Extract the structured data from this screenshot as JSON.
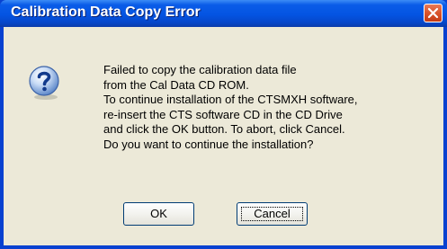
{
  "window": {
    "title": "Calibration Data Copy Error",
    "close_icon": "close-icon"
  },
  "message": {
    "icon": "question-icon",
    "lines": [
      "Failed to copy the calibration data file",
      "from the Cal Data CD ROM.",
      "To continue installation of the CTSMXH software,",
      "re-insert the CTS software CD in the CD Drive",
      "and click the OK button. To abort, click Cancel.",
      "Do you want to continue the installation?"
    ]
  },
  "buttons": {
    "ok_label": "OK",
    "cancel_label": "Cancel"
  },
  "colors": {
    "titlebar": "#0454e2",
    "client": "#ece9d8",
    "close_button": "#d9542b"
  }
}
